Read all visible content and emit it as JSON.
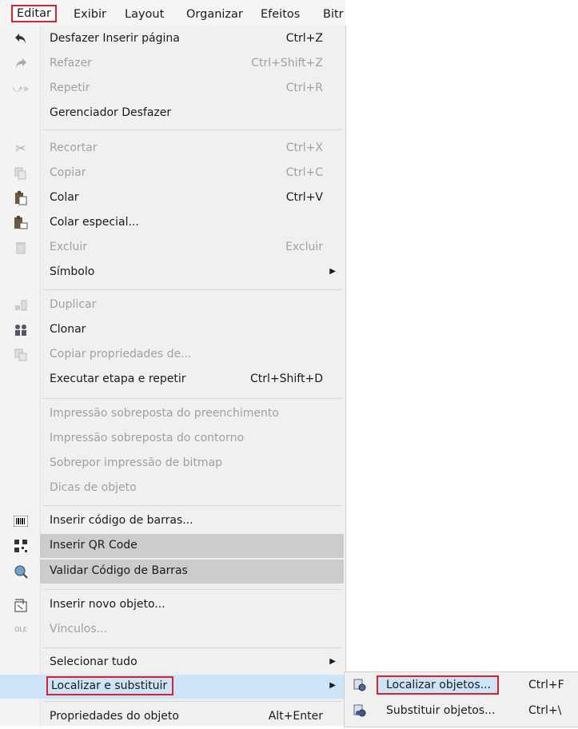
{
  "menubar": {
    "items": [
      "Editar",
      "Exibir",
      "Layout",
      "Organizar",
      "Efeitos",
      "Bitr"
    ]
  },
  "menu": {
    "undo": {
      "label": "Desfazer Inserir página",
      "shortcut": "Ctrl+Z",
      "icon": "undo-icon"
    },
    "redo": {
      "label": "Refazer",
      "shortcut": "Ctrl+Shift+Z",
      "icon": "redo-icon"
    },
    "repeat": {
      "label": "Repetir",
      "shortcut": "Ctrl+R",
      "icon": "repeat-icon"
    },
    "undo_manager": {
      "label": "Gerenciador Desfazer"
    },
    "cut": {
      "label": "Recortar",
      "shortcut": "Ctrl+X",
      "icon": "scissors-icon"
    },
    "copy": {
      "label": "Copiar",
      "shortcut": "Ctrl+C",
      "icon": "copy-icon"
    },
    "paste": {
      "label": "Colar",
      "shortcut": "Ctrl+V",
      "icon": "paste-icon"
    },
    "paste_special": {
      "label": "Colar especial...",
      "icon": "paste-special-icon"
    },
    "delete": {
      "label": "Excluir",
      "shortcut": "Excluir",
      "icon": "trash-icon"
    },
    "symbol": {
      "label": "Símbolo"
    },
    "duplicate": {
      "label": "Duplicar",
      "icon": "duplicate-icon"
    },
    "clone": {
      "label": "Clonar",
      "icon": "clone-icon"
    },
    "copy_props": {
      "label": "Copiar propriedades de...",
      "icon": "copy-properties-icon"
    },
    "step_repeat": {
      "label": "Executar etapa e repetir",
      "shortcut": "Ctrl+Shift+D"
    },
    "overprint_fill": {
      "label": "Impressão sobreposta do preenchimento"
    },
    "overprint_outline": {
      "label": "Impressão sobreposta do contorno"
    },
    "overprint_bitmap": {
      "label": "Sobrepor impressão de bitmap"
    },
    "object_hints": {
      "label": "Dicas de objeto"
    },
    "barcode": {
      "label": "Inserir código de barras...",
      "icon": "barcode-icon"
    },
    "qr": {
      "label": "Inserir QR Code",
      "icon": "qr-code-icon"
    },
    "validate": {
      "label": "Validar Código de Barras",
      "icon": "magnifier-icon"
    },
    "new_object": {
      "label": "Inserir novo objeto...",
      "icon": "insert-object-icon"
    },
    "links": {
      "label": "Vínculos...",
      "icon": "ole-icon"
    },
    "select_all": {
      "label": "Selecionar tudo"
    },
    "find_replace": {
      "label": "Localizar e substituir"
    },
    "object_props": {
      "label": "Propriedades do objeto",
      "shortcut": "Alt+Enter"
    }
  },
  "submenu": {
    "find": {
      "label": "Localizar objetos...",
      "shortcut": "Ctrl+F",
      "icon": "find-objects-icon"
    },
    "replace": {
      "label": "Substituir objetos...",
      "shortcut": "Ctrl+\\",
      "icon": "replace-objects-icon"
    }
  },
  "colors": {
    "highlight_border": "#d8212b",
    "selection": "#cce4f7",
    "hover_gray": "#cccccc"
  }
}
